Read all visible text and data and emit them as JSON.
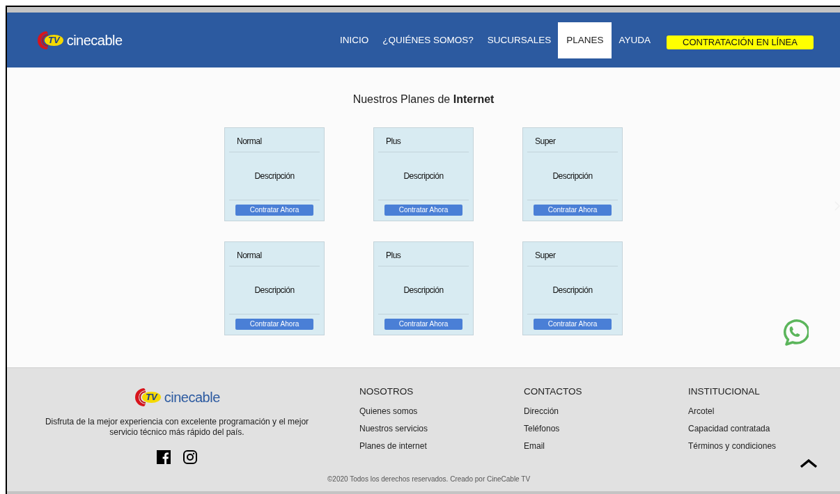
{
  "header": {
    "logo": {
      "badge": "TV",
      "name": "cinecable"
    },
    "nav": [
      {
        "label": "INICIO",
        "selected": false,
        "kind": "link"
      },
      {
        "label": "¿QUIÉNES SOMOS?",
        "selected": false,
        "kind": "link"
      },
      {
        "label": "SUCURSALES",
        "selected": false,
        "kind": "link"
      },
      {
        "label": "PLANES",
        "selected": true,
        "kind": "link"
      },
      {
        "label": "AYUDA",
        "selected": false,
        "kind": "link"
      },
      {
        "label": "CONTRATACIÓN EN LÍNEA",
        "selected": false,
        "kind": "cta"
      }
    ]
  },
  "plans": {
    "title": "Nuestros Planes de **Internet**",
    "cards": [
      {
        "name": "Normal",
        "description": "Descripción",
        "button": "Contratar Ahora"
      },
      {
        "name": "Plus",
        "description": "Descripción",
        "button": "Contratar Ahora"
      },
      {
        "name": "Super",
        "description": "Descripción",
        "button": "Contratar Ahora"
      },
      {
        "name": "Normal",
        "description": "Descripción",
        "button": "Contratar Ahora"
      },
      {
        "name": "Plus",
        "description": "Descripción",
        "button": "Contratar Ahora"
      },
      {
        "name": "Super",
        "description": "Descripción",
        "button": "Contratar Ahora"
      }
    ]
  },
  "footer": {
    "logo": {
      "badge": "TV",
      "name": "cinecable"
    },
    "tagline": "Disfruta de la mejor experiencia con excelente programación y el mejor servicio técnico más rápido del país.",
    "columns": [
      {
        "heading": "NOSOTROS",
        "links": [
          "Quienes somos",
          "Nuestros servicios",
          "Planes de internet"
        ]
      },
      {
        "heading": "CONTACTOS",
        "links": [
          "Dirección",
          "Teléfonos",
          "Email"
        ]
      },
      {
        "heading": "INSTITUCIONAL",
        "links": [
          "Arcotel",
          "Capacidad contratada",
          "Términos y condiciones"
        ]
      }
    ],
    "copyright": "©2020 Todos los derechos reservados. Creado por CineCable TV"
  }
}
